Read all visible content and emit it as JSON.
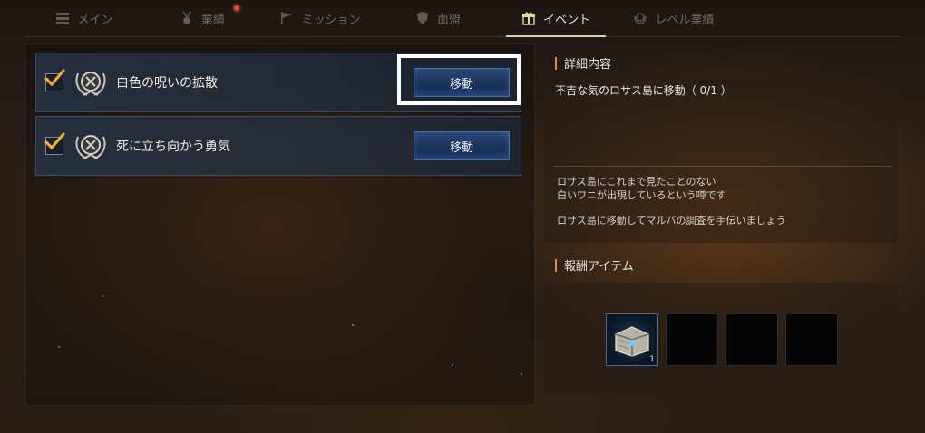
{
  "tabs": [
    {
      "label": "メイン",
      "icon": "list-icon",
      "active": false
    },
    {
      "label": "業績",
      "icon": "medal-icon",
      "active": false
    },
    {
      "label": "ミッション",
      "icon": "flag-icon",
      "active": false
    },
    {
      "label": "血盟",
      "icon": "shield-icon",
      "active": false
    },
    {
      "label": "イベント",
      "icon": "gift-icon",
      "active": true
    },
    {
      "label": "レベル業績",
      "icon": "laurel-icon",
      "active": false
    }
  ],
  "quests": [
    {
      "title": "白色の呪いの拡散",
      "button": "移動",
      "checked": true
    },
    {
      "title": "死に立ち向かう勇気",
      "button": "移動",
      "checked": true
    }
  ],
  "detail": {
    "heading": "詳細内容",
    "goal": "不吉な気のロサス島に移動（ 0/1 ）",
    "desc1": "ロサス島にこれまで見たことのない",
    "desc2": "白いワニが出現しているという噂です",
    "desc3": "ロサス島に移動してマルバの調査を手伝いましょう"
  },
  "rewards": {
    "heading": "報酬アイテム",
    "items": [
      {
        "icon": "treasure-chest-icon",
        "qty": "1"
      },
      {
        "icon": "",
        "qty": ""
      },
      {
        "icon": "",
        "qty": ""
      },
      {
        "icon": "",
        "qty": ""
      }
    ]
  },
  "colors": {
    "accent": "#e08a4a",
    "button": "#1a3158",
    "highlight": "#ffffff"
  }
}
